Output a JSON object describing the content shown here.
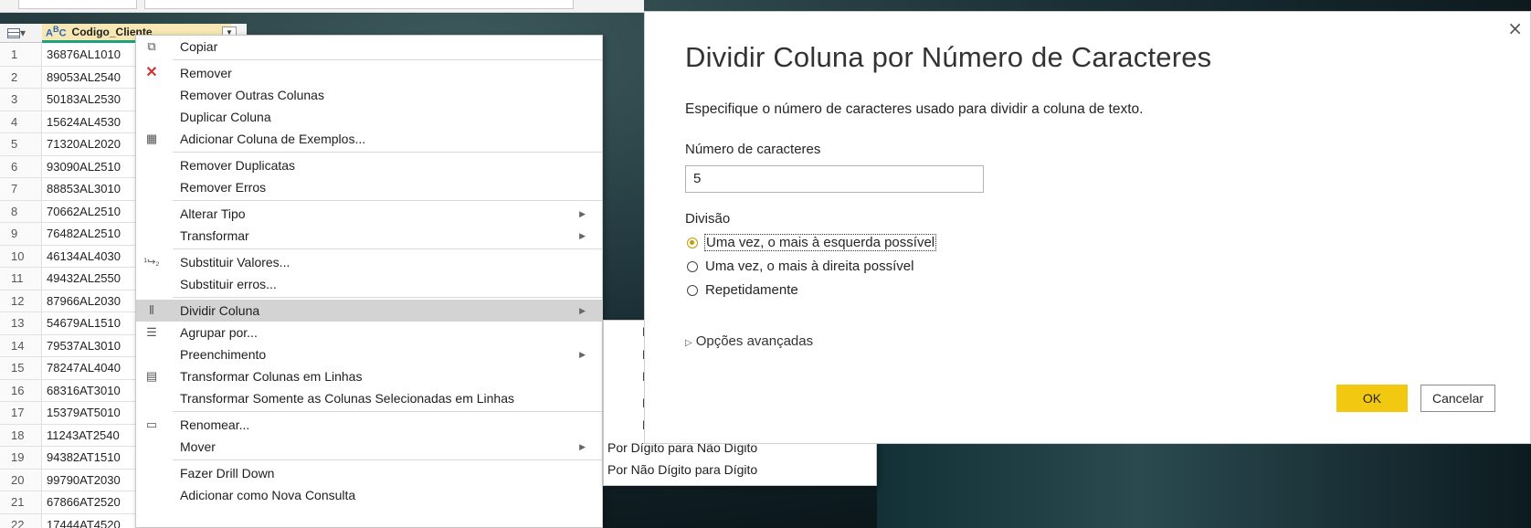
{
  "grid": {
    "column_header": "Codigo_Cliente",
    "type_icon": "A B C",
    "rows": [
      {
        "n": "1",
        "v": "36876AL1010"
      },
      {
        "n": "2",
        "v": "89053AL2540"
      },
      {
        "n": "3",
        "v": "50183AL2530"
      },
      {
        "n": "4",
        "v": "15624AL4530"
      },
      {
        "n": "5",
        "v": "71320AL2020"
      },
      {
        "n": "6",
        "v": "93090AL2510"
      },
      {
        "n": "7",
        "v": "88853AL3010"
      },
      {
        "n": "8",
        "v": "70662AL2510"
      },
      {
        "n": "9",
        "v": "76482AL2510"
      },
      {
        "n": "10",
        "v": "46134AL4030"
      },
      {
        "n": "11",
        "v": "49432AL2550"
      },
      {
        "n": "12",
        "v": "87966AL2030"
      },
      {
        "n": "13",
        "v": "54679AL1510"
      },
      {
        "n": "14",
        "v": "79537AL3010"
      },
      {
        "n": "15",
        "v": "78247AL4040"
      },
      {
        "n": "16",
        "v": "68316AT3010"
      },
      {
        "n": "17",
        "v": "15379AT5010"
      },
      {
        "n": "18",
        "v": "11243AT2540"
      },
      {
        "n": "19",
        "v": "94382AT1510"
      },
      {
        "n": "20",
        "v": "99790AT2030"
      },
      {
        "n": "21",
        "v": "67866AT2520"
      },
      {
        "n": "22",
        "v": "17444AT4520"
      }
    ]
  },
  "context_menu": {
    "copy": "Copiar",
    "remove": "Remover",
    "remove_other": "Remover Outras Colunas",
    "duplicate": "Duplicar Coluna",
    "add_from_examples": "Adicionar Coluna de Exemplos...",
    "remove_duplicates": "Remover Duplicatas",
    "remove_errors": "Remover Erros",
    "change_type": "Alterar Tipo",
    "transform": "Transformar",
    "replace_values": "Substituir Valores...",
    "replace_errors": "Substituir erros...",
    "split_column": "Dividir Coluna",
    "group_by": "Agrupar por...",
    "fill": "Preenchimento",
    "unpivot": "Transformar Colunas em Linhas",
    "unpivot_selected": "Transformar Somente as Colunas Selecionadas em Linhas",
    "rename": "Renomear...",
    "move": "Mover",
    "drill_down": "Fazer Drill Down",
    "add_new_query": "Adicionar como Nova Consulta"
  },
  "submenu": {
    "items": [
      "P",
      "P",
      "P",
      "P",
      "P",
      "Por Dígito para Não Dígito",
      "Por Não Dígito para Dígito"
    ]
  },
  "dialog": {
    "title": "Dividir Coluna por Número de Caracteres",
    "description": "Especifique o número de caracteres usado para dividir a coluna de texto.",
    "num_chars_label": "Número de caracteres",
    "num_chars_value": "5",
    "split_label": "Divisão",
    "options": [
      "Uma vez, o mais à esquerda possível",
      "Uma vez, o mais à direita possível",
      "Repetidamente"
    ],
    "selected_option": "Uma vez, o mais à esquerda possível",
    "advanced": "Opções avançadas",
    "ok": "OK",
    "cancel": "Cancelar",
    "close": "×"
  },
  "colors": {
    "accent_yellow": "#f2c811",
    "column_header_bg": "#f7e7b4",
    "column_underline": "#1ea27b",
    "menu_highlight": "#d3d3d3"
  }
}
